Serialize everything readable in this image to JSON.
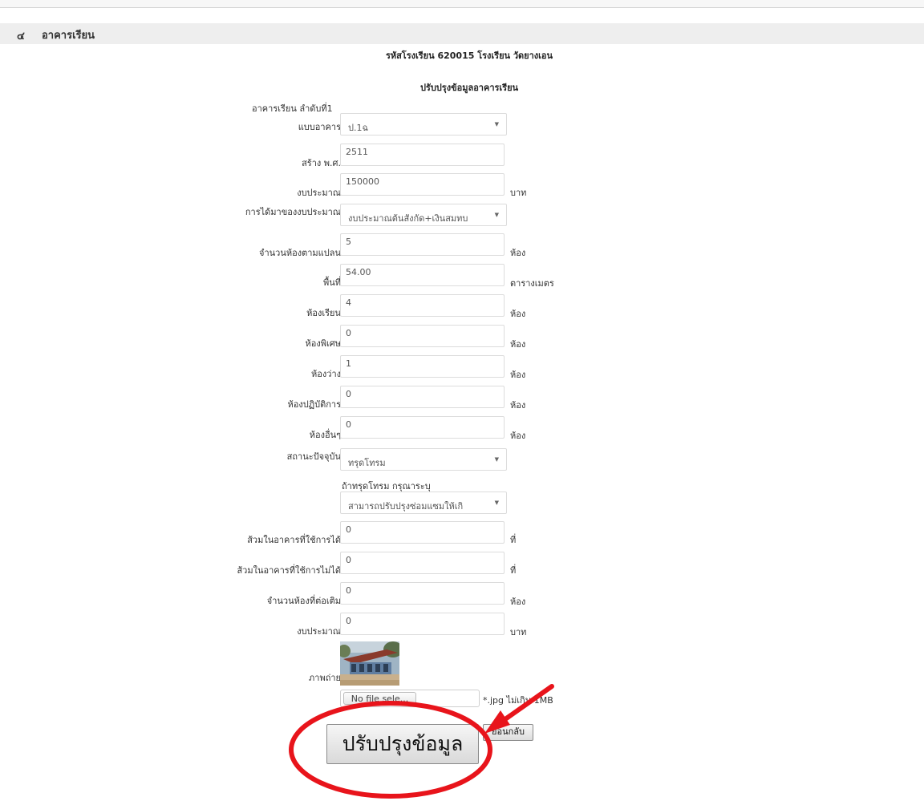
{
  "section": {
    "number": "๔",
    "title": "อาคารเรียน"
  },
  "school_heading": "รหัสโรงเรียน 620015 โรงเรียน วัดยางเอน",
  "form_title": "ปรับปรุงข้อมูลอาคารเรียน",
  "building_label": "อาคารเรียน ลำดับที่1",
  "fields": {
    "building_type": {
      "label": "แบบอาคาร",
      "value": "ป.1ฉ"
    },
    "built_year": {
      "label": "สร้าง พ.ศ.",
      "value": "2511"
    },
    "budget": {
      "label": "งบประมาณ",
      "value": "150000",
      "unit": "บาท"
    },
    "budget_source": {
      "label": "การได้มาของงบประมาณ",
      "value": "งบประมาณต้นสังกัด+เงินสมทบ"
    },
    "planned_rooms": {
      "label": "จำนวนห้องตามแปลน",
      "value": "5",
      "unit": "ห้อง"
    },
    "area": {
      "label": "พื้นที่",
      "value": "54.00",
      "unit": "ตารางเมตร"
    },
    "classrooms": {
      "label": "ห้องเรียน",
      "value": "4",
      "unit": "ห้อง"
    },
    "special_rooms": {
      "label": "ห้องพิเศษ",
      "value": "0",
      "unit": "ห้อง"
    },
    "vacant_rooms": {
      "label": "ห้องว่าง",
      "value": "1",
      "unit": "ห้อง"
    },
    "practice_rooms": {
      "label": "ห้องปฏิบัติการ",
      "value": "0",
      "unit": "ห้อง"
    },
    "other_rooms": {
      "label": "ห้องอื่นๆ",
      "value": "0",
      "unit": "ห้อง"
    },
    "current_status": {
      "label": "สถานะปัจจุบัน",
      "value": "ทรุดโทรม"
    },
    "deteriorated_note": {
      "label": "ถ้าทรุดโทรม กรุณาระบุ",
      "value": "สามารถปรับปรุงซ่อมแซมให้เกิ"
    },
    "toilets_usable": {
      "label": "ส้วมในอาคารที่ใช้การได้",
      "value": "0",
      "unit": "ที่"
    },
    "toilets_unusable": {
      "label": "ส้วมในอาคารที่ใช้การไม่ได้",
      "value": "0",
      "unit": "ที่"
    },
    "added_rooms": {
      "label": "จำนวนห้องที่ต่อเติม",
      "value": "0",
      "unit": "ห้อง"
    },
    "added_budget": {
      "label": "งบประมาณ",
      "value": "0",
      "unit": "บาท"
    }
  },
  "photo": {
    "label": "ภาพถ่าย"
  },
  "file_input": {
    "button_label": "No file sele...",
    "hint": "*.jpg ไม่เกิน 1MB"
  },
  "buttons": {
    "submit": "ปรับปรุงข้อมูล",
    "back": "ย้อนกลับ"
  },
  "annotation": {
    "color": "#e8141b"
  }
}
